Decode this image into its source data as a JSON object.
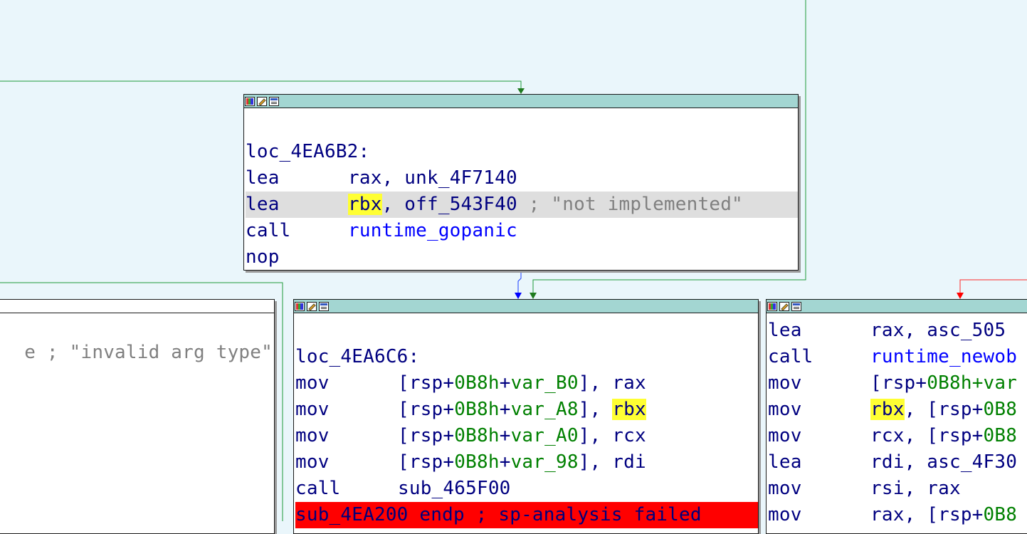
{
  "app": {
    "view": "IDA graph view"
  },
  "colors": {
    "background": "#eaf6fb",
    "titlebar": "#a3d6d2",
    "edge_true": "#008000",
    "edge_false": "#ff0000",
    "edge_flow": "#0000ff",
    "highlight_register": "#ffff33",
    "error_line": "#ff0000"
  },
  "node_main": {
    "label": "loc_4EA6B2:",
    "lines": [
      {
        "mn": "lea",
        "op1": "rax",
        "sep": ", ",
        "op2": "unk_4F7140"
      },
      {
        "mn": "lea",
        "op1": "rbx",
        "sep": ", ",
        "op2": "off_543F40",
        "comment": " ; \"not implemented\""
      },
      {
        "mn": "call",
        "op1": "runtime_gopanic"
      },
      {
        "mn": "nop"
      }
    ]
  },
  "node_left": {
    "comment_fragment": "e ; \"invalid arg type\""
  },
  "node_center": {
    "label": "loc_4EA6C6:",
    "lines": [
      {
        "mn": "mov",
        "a": "[rsp+",
        "b": "0B8h",
        "c": "+",
        "d": "var_B0",
        "e": "], ",
        "f": "rax"
      },
      {
        "mn": "mov",
        "a": "[rsp+",
        "b": "0B8h",
        "c": "+",
        "d": "var_A8",
        "e": "], ",
        "f": "rbx"
      },
      {
        "mn": "mov",
        "a": "[rsp+",
        "b": "0B8h",
        "c": "+",
        "d": "var_A0",
        "e": "], ",
        "f": "rcx"
      },
      {
        "mn": "mov",
        "a": "[rsp+",
        "b": "0B8h",
        "c": "+",
        "d": "var_98",
        "e": "], ",
        "f": "rdi"
      },
      {
        "mn": "call",
        "op": "sub_465F00"
      }
    ],
    "error_line": "sub_4EA200 endp ; sp-analysis failed"
  },
  "node_right": {
    "lines": [
      {
        "mn": "lea",
        "text": "rax, asc_505"
      },
      {
        "mn": "call",
        "text": "runtime_newob"
      },
      {
        "mn": "mov",
        "a": "[rsp+",
        "b": "0B8h",
        "c": "+var"
      },
      {
        "mn": "mov",
        "r": "rbx",
        "t": ", [rsp+",
        "b": "0B8"
      },
      {
        "mn": "mov",
        "r": "rcx",
        "t": ", [rsp+",
        "b": "0B8"
      },
      {
        "mn": "lea",
        "text": "rdi, asc_4F30"
      },
      {
        "mn": "mov",
        "text": "rsi, rax"
      },
      {
        "mn": "mov",
        "t": "rax, [rsp+",
        "b": "0B8"
      }
    ]
  }
}
